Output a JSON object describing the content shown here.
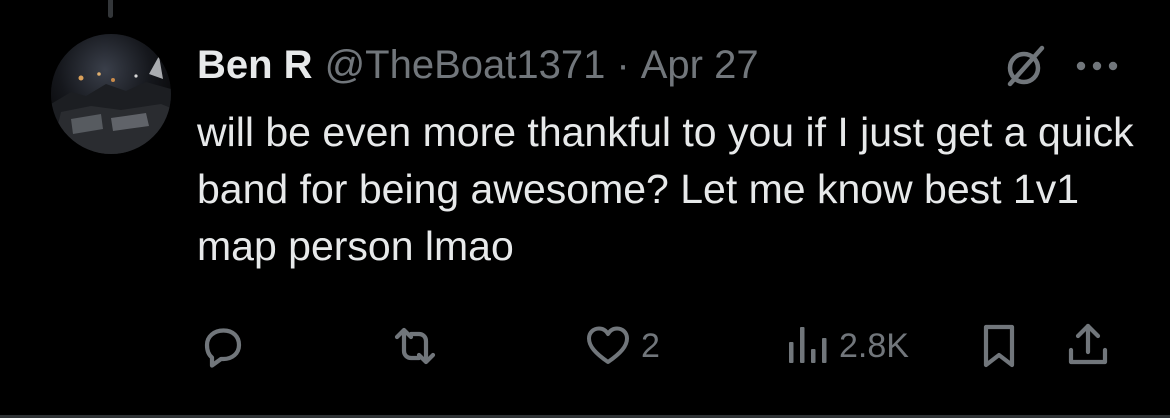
{
  "tweet": {
    "display_name": "Ben R",
    "handle": "@TheBoat1371",
    "separator": "·",
    "date": "Apr 27",
    "text": "will be even more thankful to you if I just get a quick band for being awesome? Let me know best 1v1 map person lmao"
  },
  "header_icons": {
    "grok": "grok-icon",
    "more": "more-icon"
  },
  "actions": {
    "reply": {
      "icon": "reply-icon"
    },
    "retweet": {
      "icon": "retweet-icon"
    },
    "like": {
      "icon": "heart-icon",
      "count": "2"
    },
    "views": {
      "icon": "views-icon",
      "count": "2.8K"
    },
    "bookmark": {
      "icon": "bookmark-icon"
    },
    "share": {
      "icon": "share-icon"
    }
  },
  "colors": {
    "background": "#000000",
    "text_primary": "#e7e9ea",
    "text_secondary": "#71767b",
    "divider": "#2f3336"
  }
}
